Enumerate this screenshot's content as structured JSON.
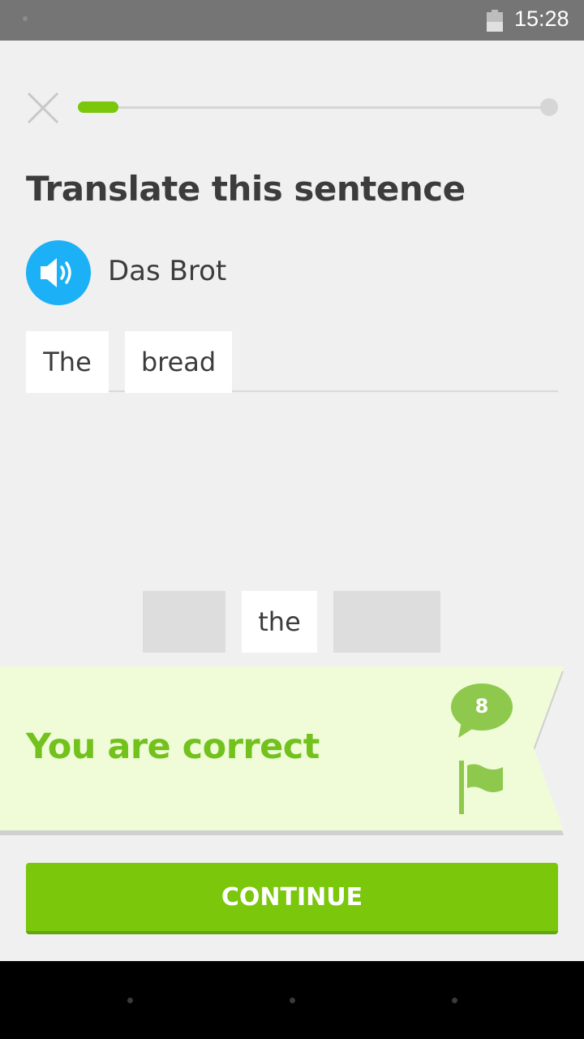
{
  "status_bar": {
    "time": "15:28",
    "battery_icon": "battery-icon"
  },
  "header": {
    "close_icon": "close-icon",
    "progress_fraction": 0.085
  },
  "exercise": {
    "title": "Translate this sentence",
    "speaker_icon": "speaker-icon",
    "prompt": "Das Brot",
    "answer_tiles": [
      "The",
      "bread"
    ],
    "word_bank": [
      "the"
    ]
  },
  "feedback": {
    "message": "You are correct",
    "comment_count": "8",
    "discussion_icon": "speech-bubble-icon",
    "report_icon": "flag-icon"
  },
  "footer": {
    "continue_label": "CONTINUE"
  },
  "colors": {
    "accent_green": "#7ac70c",
    "correct_text": "#72c11d",
    "banner_bg": "#f0fcd8",
    "speaker_blue": "#1cb0f6"
  }
}
